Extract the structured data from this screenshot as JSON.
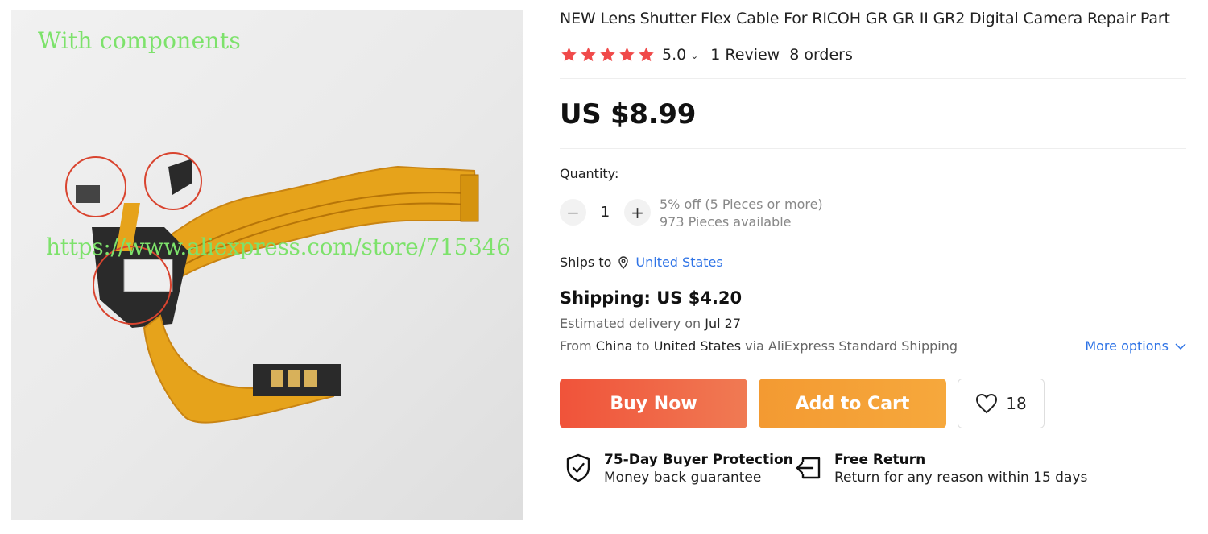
{
  "image": {
    "caption": "With components",
    "watermark": "https://www.aliexpress.com/store/715346"
  },
  "product": {
    "title": "NEW Lens Shutter Flex Cable For RICOH GR GR II GR2 Digital Camera Repair Part",
    "rating_value": "5.0",
    "rating_stars": 5,
    "reviews_label": "1 Review",
    "orders_label": "8 orders",
    "price": "US $8.99"
  },
  "quantity": {
    "label": "Quantity:",
    "value": "1",
    "discount_text": "5% off (5 Pieces or more)",
    "available_text": "973 Pieces available"
  },
  "shipping": {
    "ships_to_label": "Ships to",
    "ships_to_country": "United States",
    "cost": "Shipping: US $4.20",
    "delivery_prefix": "Estimated delivery on",
    "delivery_date": "Jul 27",
    "from_label": "From",
    "from_country": "China",
    "to_label": "to",
    "to_country": "United States",
    "via_text": "via AliExpress Standard Shipping",
    "more_options": "More options"
  },
  "actions": {
    "buy_now": "Buy Now",
    "add_to_cart": "Add to Cart",
    "wishlist_count": "18"
  },
  "guarantees": [
    {
      "title": "75-Day Buyer Protection",
      "subtitle": "Money back guarantee"
    },
    {
      "title": "Free Return",
      "subtitle": "Return for any reason within 15 days"
    }
  ],
  "colors": {
    "star": "#f04a4a",
    "link": "#2e73e6",
    "buy_now": "#f0533a",
    "add_to_cart": "#f39a32",
    "caption_green": "#7de26b"
  }
}
